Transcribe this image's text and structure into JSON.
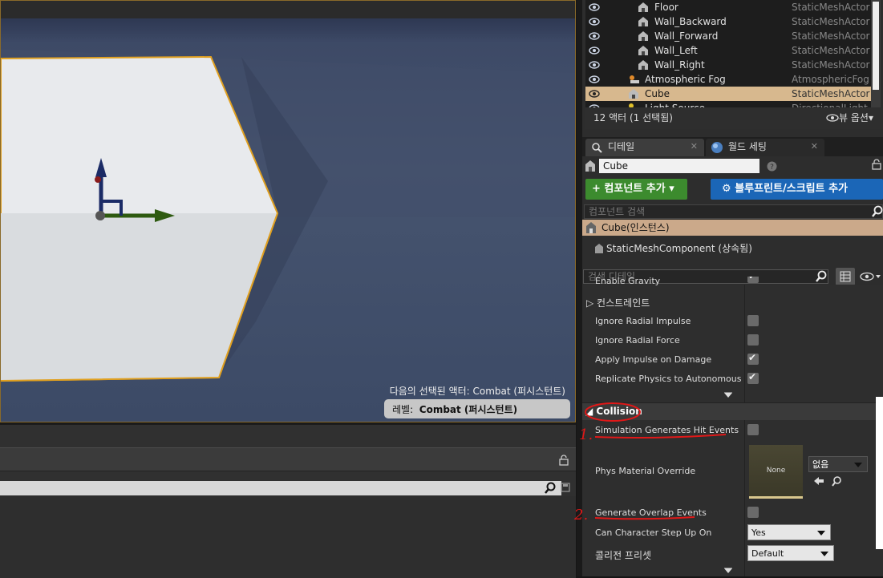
{
  "viewport": {
    "info_line": "다음의 선택된 액터:  Combat (퍼시스턴트)",
    "level_label": "레벨:",
    "level_value": "Combat (퍼시스턴트)"
  },
  "outliner": {
    "rows": [
      {
        "name": "Floor",
        "type": "StaticMeshActor"
      },
      {
        "name": "Wall_Backward",
        "type": "StaticMeshActor"
      },
      {
        "name": "Wall_Forward",
        "type": "StaticMeshActor"
      },
      {
        "name": "Wall_Left",
        "type": "StaticMeshActor"
      },
      {
        "name": "Wall_Right",
        "type": "StaticMeshActor"
      },
      {
        "name": "Atmospheric Fog",
        "type": "AtmosphericFog"
      },
      {
        "name": "Cube",
        "type": "StaticMeshActor"
      },
      {
        "name": "Light Source",
        "type": "DirectionalLight"
      }
    ],
    "footer_count": "12 액터 (1 선택됨)",
    "view_options": "뷰 옵션"
  },
  "tabs": {
    "details": "디테일",
    "world_settings": "월드 세팅",
    "close": "✕"
  },
  "details": {
    "actor_name": "Cube",
    "add_component": "+ 컴포넌트 추가",
    "blueprint_script": "블루프린트/스크립트 추가",
    "component_search_placeholder": "컴포넌트 검색",
    "component_root": "Cube(인스턴스)",
    "component_child": "StaticMeshComponent (상속됨)",
    "detail_search_placeholder": "검색 디테일",
    "partial_row": "Enable Gravity",
    "constraints": "컨스트레인트",
    "collision_header": "Collision"
  },
  "properties": [
    {
      "label": "Ignore Radial Impulse",
      "checked": false
    },
    {
      "label": "Ignore Radial Force",
      "checked": false
    },
    {
      "label": "Apply Impulse on Damage",
      "checked": true
    },
    {
      "label": "Replicate Physics to Autonomous Proxy",
      "checked": true
    }
  ],
  "collision": {
    "sim_hit_events": "Simulation Generates Hit Events",
    "phys_material_override": "Phys Material Override",
    "material_thumb": "None",
    "material_combo": "없음",
    "overlap_events": "Generate Overlap Events",
    "can_step_up": "Can Character Step Up On",
    "can_step_up_value": "Yes",
    "collision_preset": "콜리전 프리셋",
    "collision_preset_value": "Default"
  },
  "annotations": {
    "mark_1": "1.",
    "mark_2": "2."
  },
  "colors": {
    "selection": "#d7b88e",
    "green_button": "#3c8b2e",
    "blue_button": "#1b66b7",
    "annotation_red": "#e01818"
  }
}
